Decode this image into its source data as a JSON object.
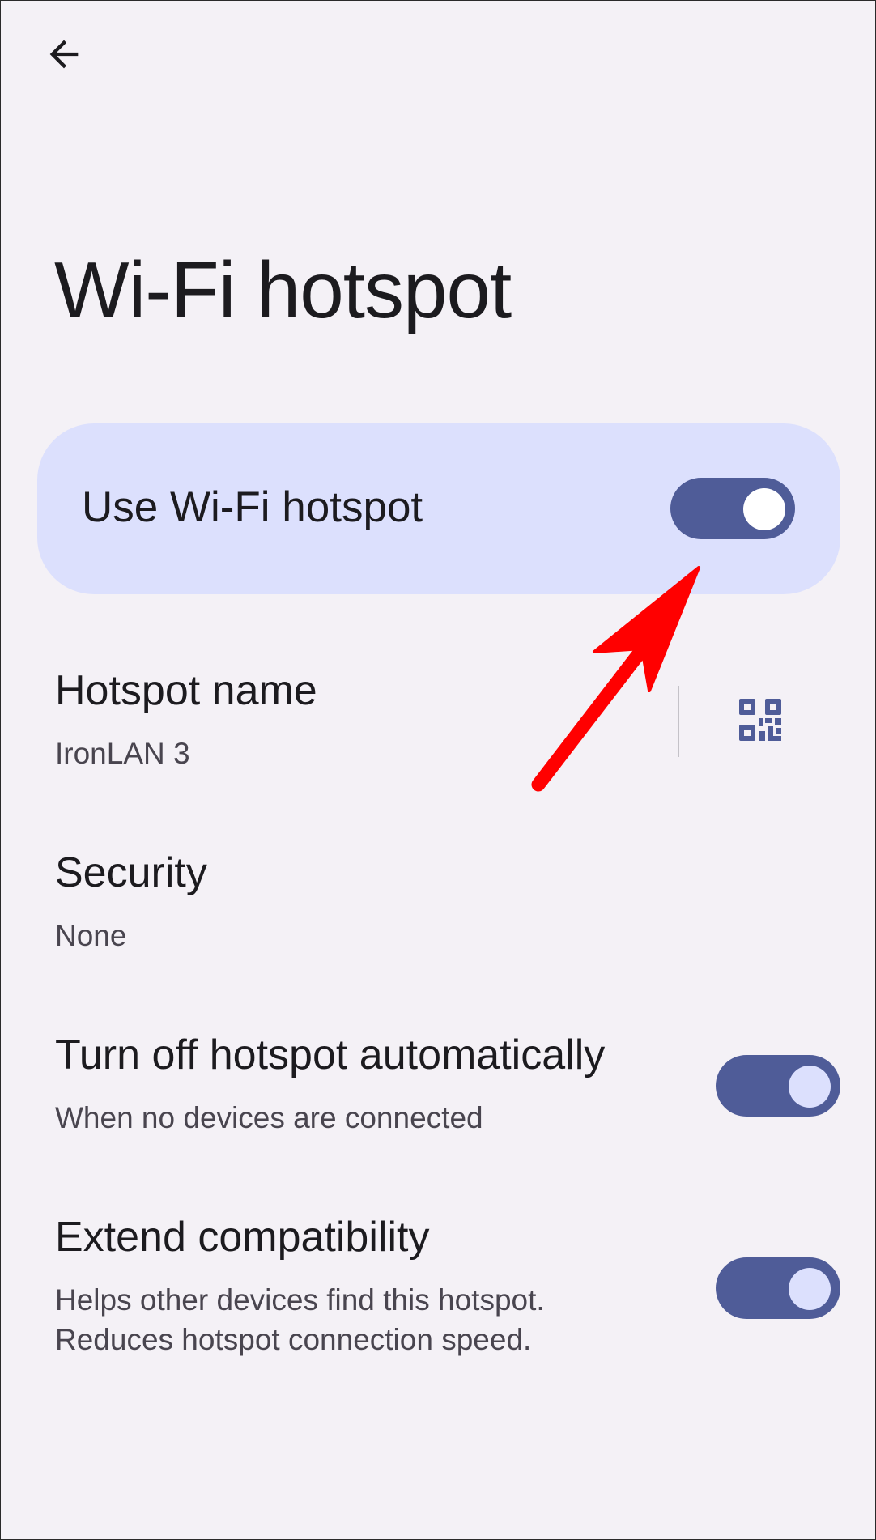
{
  "header": {
    "back_icon": "arrow-back-icon",
    "title": "Wi-Fi hotspot"
  },
  "main_toggle": {
    "label": "Use Wi-Fi hotspot",
    "checked": true
  },
  "settings": {
    "hotspot_name": {
      "title": "Hotspot name",
      "value": "IronLAN 3",
      "action_icon": "qr-code-icon"
    },
    "security": {
      "title": "Security",
      "value": "None"
    },
    "turn_off_automatically": {
      "title": "Turn off hotspot automatically",
      "summary": "When no devices are connected",
      "checked": true
    },
    "extend_compatibility": {
      "title": "Extend compatibility",
      "summary_line1": "Helps other devices find this hotspot.",
      "summary_line2": "Reduces hotspot connection speed.",
      "checked": true
    }
  },
  "colors": {
    "background": "#f4f1f6",
    "card": "#dce0fd",
    "switch_track": "#4f5c98",
    "switch_thumb": "#dce0fd",
    "annotation": "#ff0000"
  }
}
